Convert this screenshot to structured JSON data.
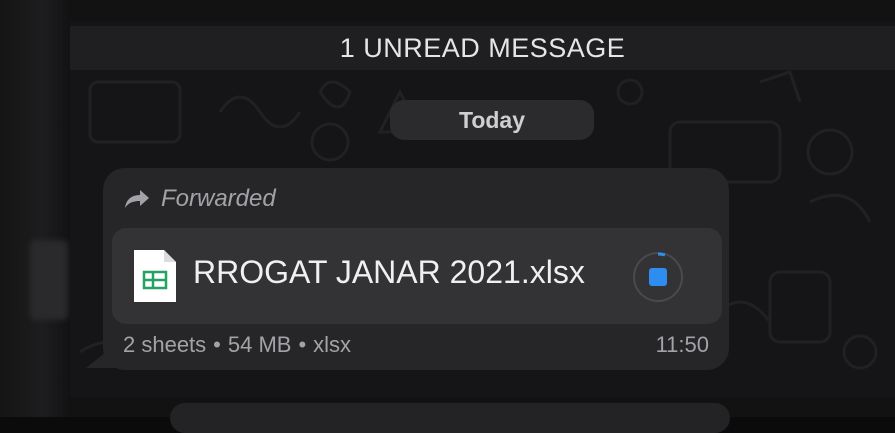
{
  "banner": {
    "text": "1 UNREAD MESSAGE"
  },
  "date_divider": {
    "text": "Today"
  },
  "message": {
    "forwarded_label": "Forwarded",
    "file": {
      "name": "RROGAT JANAR 2021.xlsx",
      "icon": "spreadsheet-icon",
      "download_icon": "stop-download-icon"
    },
    "meta": {
      "sheets": "2 sheets",
      "size": "54 MB",
      "type": "xlsx",
      "separator": "•"
    },
    "time": "11:50"
  },
  "colors": {
    "accent": "#2e8ef0",
    "bubble": "#262628",
    "background": "#151517",
    "sheet_green": "#21a366"
  }
}
